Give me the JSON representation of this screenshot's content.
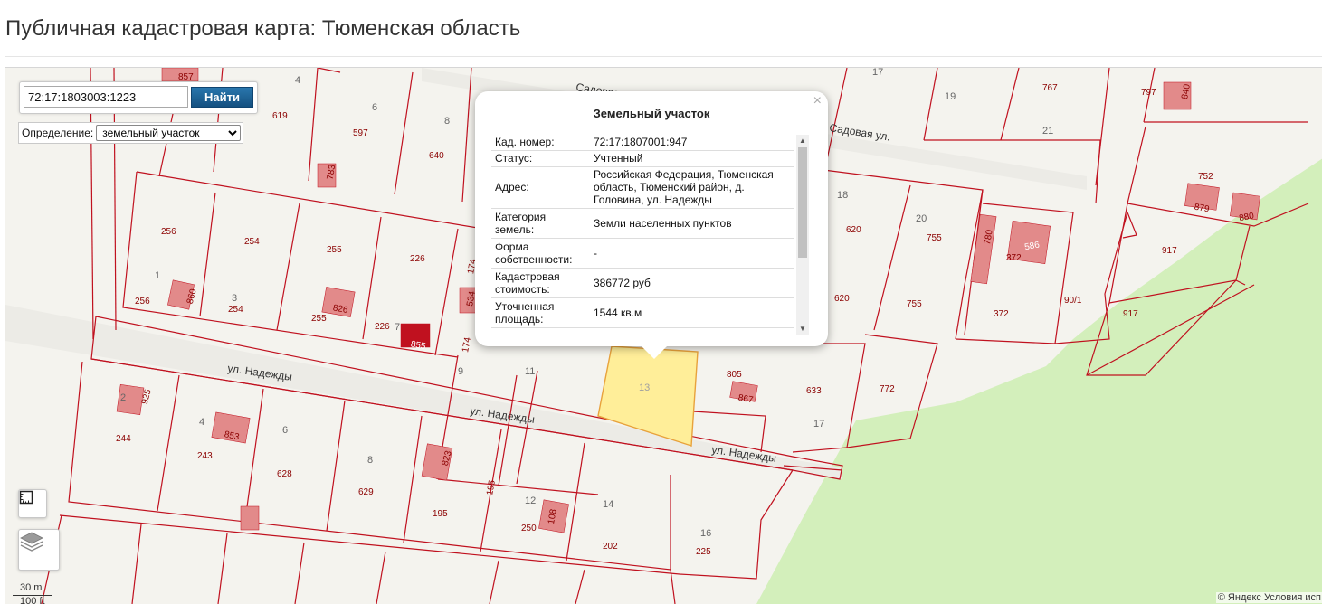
{
  "page": {
    "title": "Публичная кадастровая карта: Тюменская область"
  },
  "search": {
    "value": "72:17:1803003:1223",
    "button_label": "Найти"
  },
  "definition": {
    "label": "Определение:",
    "selected": "земельный участок"
  },
  "popup": {
    "title": "Земельный участок",
    "close": "×",
    "rows": [
      {
        "key": "Кад. номер:",
        "value": "72:17:1807001:947"
      },
      {
        "key": "Статус:",
        "value": "Учтенный"
      },
      {
        "key": "Адрес:",
        "value": "Российская Федерация, Тюменская область, Тюменский район, д. Головина, ул. Надежды"
      },
      {
        "key": "Категория земель:",
        "value": "Земли населенных пунктов"
      },
      {
        "key": "Форма собственности:",
        "value": "-"
      },
      {
        "key": "Кадастровая стоимость:",
        "value": "386772 руб"
      },
      {
        "key": "Уточненная площадь:",
        "value": "1544 кв.м"
      }
    ]
  },
  "map": {
    "streets": [
      "Садовая ул.",
      "Садовая ул.",
      "ул. Надежды",
      "ул. Надежды",
      "ул. Надежды"
    ],
    "scale": {
      "metric": "30 m",
      "imperial": "100 ft"
    },
    "attribution": "© Яндекс  Условия исп",
    "parcel_numbers": [
      "857",
      "619",
      "597",
      "640",
      "783",
      "256",
      "254",
      "255",
      "226",
      "174",
      "534",
      "256",
      "860",
      "254",
      "826",
      "255",
      "855",
      "226",
      "174",
      "925",
      "244",
      "853",
      "243",
      "628",
      "629",
      "823",
      "195",
      "195",
      "108",
      "250",
      "202",
      "225",
      "805",
      "867",
      "633",
      "772",
      "13",
      "620",
      "620",
      "755",
      "755",
      "780",
      "586",
      "372",
      "372",
      "90/1",
      "917",
      "917",
      "767",
      "797",
      "840",
      "752",
      "879",
      "880"
    ],
    "block_numbers": [
      "4",
      "6",
      "8",
      "1",
      "3",
      "7",
      "2",
      "4",
      "6",
      "8",
      "12",
      "14",
      "16",
      "17",
      "9",
      "11",
      "18",
      "20",
      "19",
      "21",
      "17"
    ]
  },
  "colors": {
    "parcel_border": "#c0111f",
    "parcel_selected": "#ffee99",
    "building": "#e28a8a",
    "building_dark": "#c0111f",
    "green_area": "#d3efbb",
    "button": "#1d5f8f"
  },
  "icons": {
    "ruler": "ruler-icon",
    "layers": "layers-icon"
  }
}
